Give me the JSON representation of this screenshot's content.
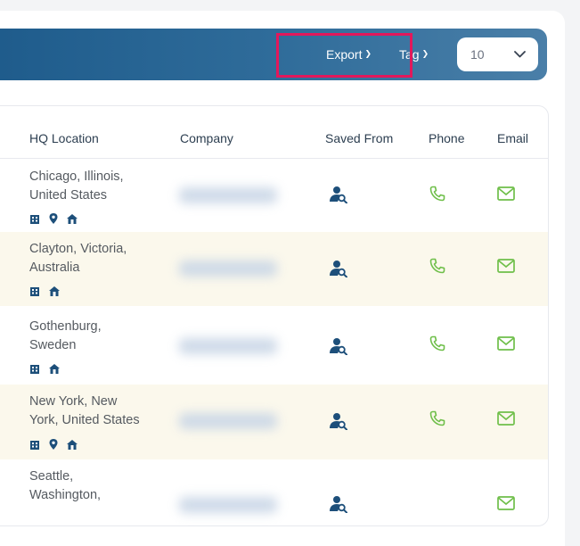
{
  "toolbar": {
    "export_label": "Export",
    "tag_label": "Tag",
    "page_size_value": "10"
  },
  "columns": {
    "hq_location": "HQ Location",
    "company": "Company",
    "saved_from": "Saved From",
    "phone": "Phone",
    "email": "Email"
  },
  "rows": [
    {
      "location_line1": "Chicago, Illinois,",
      "location_line2": "United States",
      "icons": [
        "building-icon",
        "map-pin-icon",
        "home-icon"
      ]
    },
    {
      "location_line1": "Clayton, Victoria,",
      "location_line2": "Australia",
      "icons": [
        "building-icon",
        "home-icon"
      ]
    },
    {
      "location_line1": "Gothenburg,",
      "location_line2": "Sweden",
      "icons": [
        "building-icon",
        "home-icon"
      ]
    },
    {
      "location_line1": "New York, New",
      "location_line2": "York, United States",
      "icons": [
        "building-icon",
        "map-pin-icon",
        "home-icon"
      ]
    },
    {
      "location_line1": "Seattle,",
      "location_line2": "Washington,",
      "icons": []
    }
  ],
  "colors": {
    "toolbar_start": "#1f5c8c",
    "toolbar_end": "#4a7fa8",
    "highlight": "#e2185b",
    "icon_blue": "#1d4f7a",
    "icon_green": "#6fbf4a",
    "alt_row": "#fbf8ec"
  }
}
